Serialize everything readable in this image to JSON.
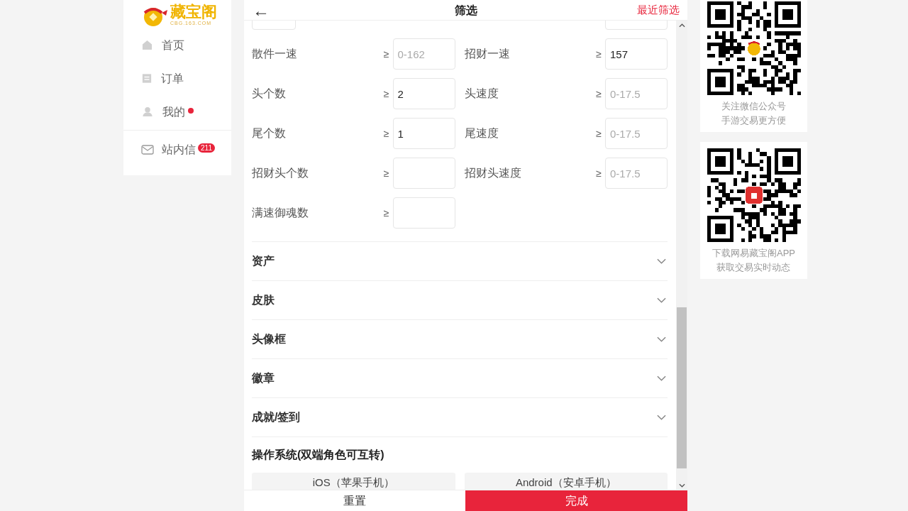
{
  "sidebar": {
    "logo": {
      "name": "藏宝阁",
      "domain": "CBG.163.COM"
    },
    "items": [
      {
        "label": "首页",
        "dot": false,
        "selected": false
      },
      {
        "label": "订单",
        "dot": false,
        "selected": false
      },
      {
        "label": "我的",
        "dot": true,
        "selected": false
      }
    ],
    "messages": {
      "label": "站内信",
      "badge": "211"
    }
  },
  "filter": {
    "title": "筛选",
    "back": "←",
    "recent": "最近筛选",
    "fields": [
      {
        "label": "散件一速",
        "sign": "≥",
        "placeholder": "0-162"
      },
      {
        "label": "招财一速",
        "sign": "≥",
        "value": "157"
      },
      {
        "label": "头个数",
        "sign": "≥",
        "value": "2"
      },
      {
        "label": "头速度",
        "sign": "≥",
        "placeholder": "0-17.5"
      },
      {
        "label": "尾个数",
        "sign": "≥",
        "value": "1"
      },
      {
        "label": "尾速度",
        "sign": "≥",
        "placeholder": "0-17.5"
      },
      {
        "label": "招财头个数",
        "sign": "≥"
      },
      {
        "label": "招财头速度",
        "sign": "≥",
        "placeholder": "0-17.5"
      },
      {
        "label": "满速御魂数",
        "sign": "≥"
      }
    ],
    "sections": [
      {
        "label": "资产",
        "expanded": false
      },
      {
        "label": "皮肤",
        "expanded": false
      },
      {
        "label": "头像框",
        "expanded": false
      },
      {
        "label": "徽章",
        "expanded": false
      },
      {
        "label": "成就/签到",
        "expanded": false
      }
    ],
    "os": {
      "title": "操作系统(双端角色可互转)",
      "options": [
        {
          "label": "iOS（苹果手机）",
          "selected": false
        },
        {
          "label": "Android（安卓手机）",
          "selected": false
        }
      ]
    },
    "footer": {
      "reset": "重置",
      "done": "完成"
    }
  },
  "qr_cards": [
    {
      "lines": [
        "关注微信公众号",
        "手游交易更方便"
      ]
    },
    {
      "lines": [
        "下载网易藏宝阁APP",
        "获取交易实时动态"
      ]
    }
  ]
}
